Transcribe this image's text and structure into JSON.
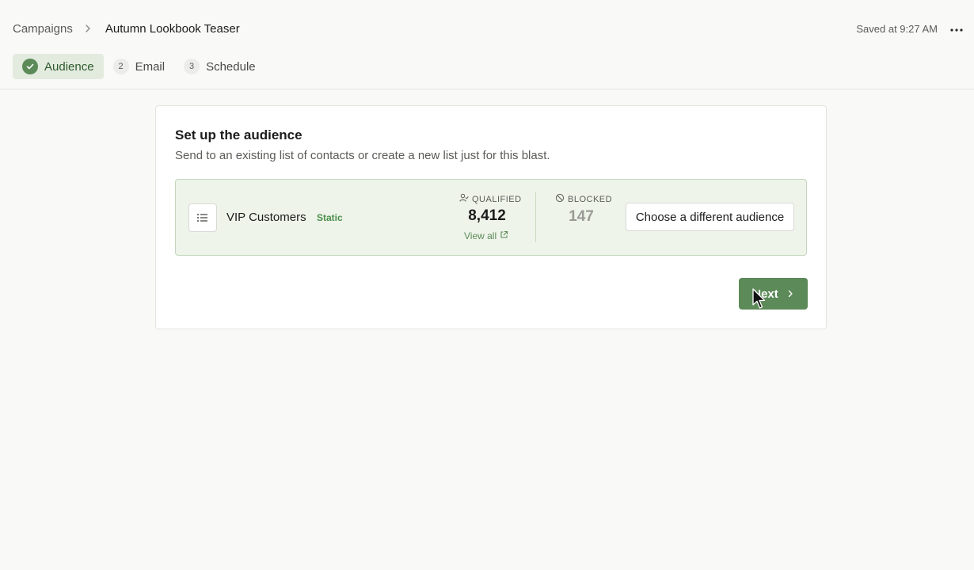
{
  "header": {
    "breadcrumb": {
      "parent": "Campaigns",
      "current": "Autumn Lookbook Teaser"
    },
    "saved_status": "Saved at 9:27 AM",
    "more_icon": "ellipsis-icon"
  },
  "steps": [
    {
      "label": "Audience",
      "state": "complete",
      "icon": "check-icon"
    },
    {
      "number": "2",
      "label": "Email",
      "state": "pending"
    },
    {
      "number": "3",
      "label": "Schedule",
      "state": "pending"
    }
  ],
  "main": {
    "title": "Set up the audience",
    "subtitle": "Send to an existing list of contacts or create a new list just for this blast.",
    "audience": {
      "icon": "list-icon",
      "name": "VIP Customers",
      "type_badge": "Static",
      "qualified": {
        "label": "QUALIFIED",
        "icon": "person-check-icon",
        "value": "8,412",
        "link": "View all",
        "link_icon": "external-link-icon"
      },
      "blocked": {
        "label": "BLOCKED",
        "icon": "block-icon",
        "value": "147"
      },
      "change_button": "Choose a different audience"
    },
    "next_button": "Next"
  },
  "colors": {
    "accent": "#5c8a58",
    "accent_light": "#e3ebdf",
    "audience_bg": "#eef4ea",
    "page_bg": "#f9f9f7"
  }
}
